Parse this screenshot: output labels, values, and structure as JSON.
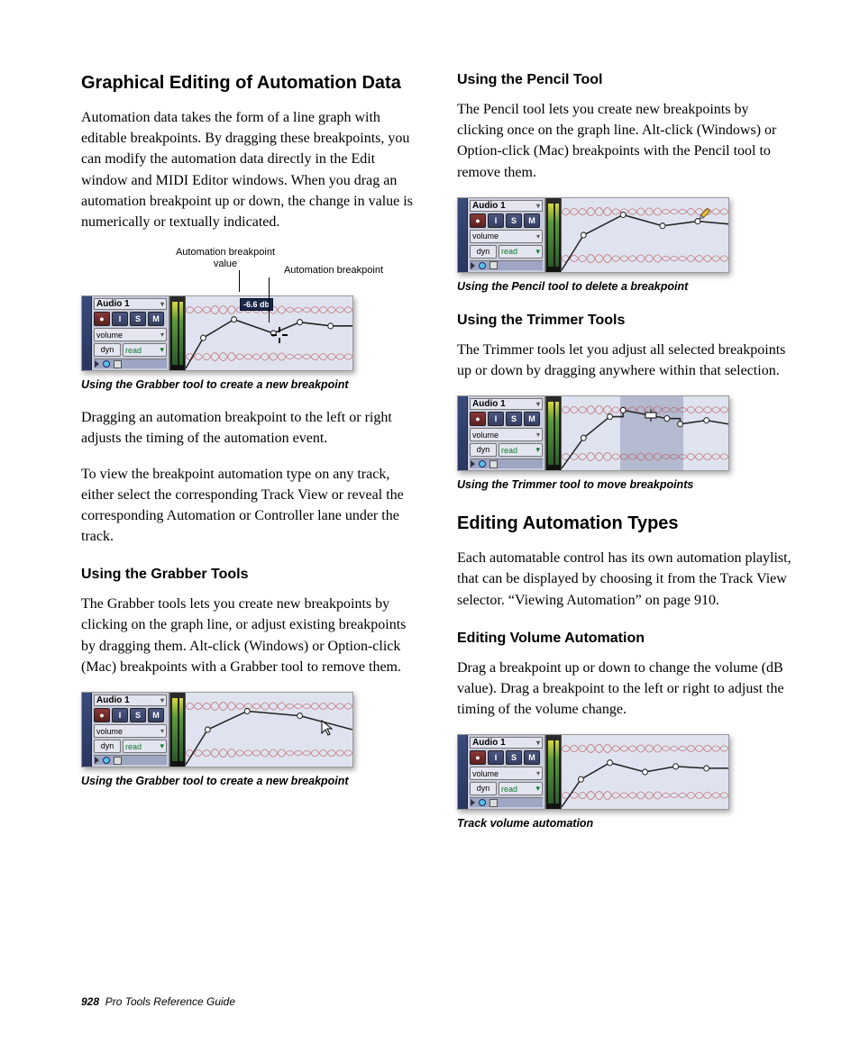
{
  "left": {
    "h2": "Graphical Editing of Automation Data",
    "p1": "Automation data takes the form of a line graph with editable breakpoints. By dragging these breakpoints, you can modify the automation data directly in the Edit window and MIDI Editor windows. When you drag an automation breakpoint up or down, the change in value is numerically or textually indicated.",
    "anno1": "Automation breakpoint value",
    "anno2": "Automation breakpoint",
    "cap1": "Using the Grabber tool to create a new breakpoint",
    "p2": "Dragging an automation breakpoint to the left or right adjusts the timing of the automation event.",
    "p3": "To view the breakpoint automation type on any track, either select the corresponding Track View or reveal the corresponding Automation or Controller lane under the track.",
    "h3a": "Using the Grabber Tools",
    "p4": "The Grabber tools lets you create new breakpoints by clicking on the graph line, or adjust existing breakpoints by dragging them. Alt-click (Windows) or Option-click (Mac) breakpoints with a Grabber tool to remove them.",
    "cap2": "Using the Grabber tool to create a new breakpoint"
  },
  "right": {
    "h3a": "Using the Pencil Tool",
    "p1": "The Pencil tool lets you create new breakpoints by clicking once on the graph line. Alt-click (Windows) or Option-click (Mac) breakpoints with the Pencil tool to remove them.",
    "cap1": "Using the Pencil tool to delete a breakpoint",
    "h3b": "Using the Trimmer Tools",
    "p2": "The Trimmer tools let you adjust all selected breakpoints up or down by dragging anywhere within that selection.",
    "cap2": "Using the Trimmer tool to move breakpoints",
    "h2": "Editing Automation Types",
    "p3": "Each automatable control has its own automation playlist, that can be displayed by choosing it from the Track View selector. “Viewing Automation” on page 910.",
    "h3c": "Editing Volume Automation",
    "p4": "Drag a breakpoint up or down to change the volume (dB value). Drag a breakpoint to the left or right to adjust the timing of the volume change.",
    "cap3": "Track volume automation"
  },
  "track": {
    "name": "Audio 1",
    "volume": "volume",
    "dyn": "dyn",
    "read": "read",
    "badge": "-6.6 db",
    "buttons": {
      "rec": "●",
      "i": "I",
      "s": "S",
      "m": "M"
    }
  },
  "footer": {
    "page": "928",
    "title": "Pro Tools Reference Guide"
  }
}
